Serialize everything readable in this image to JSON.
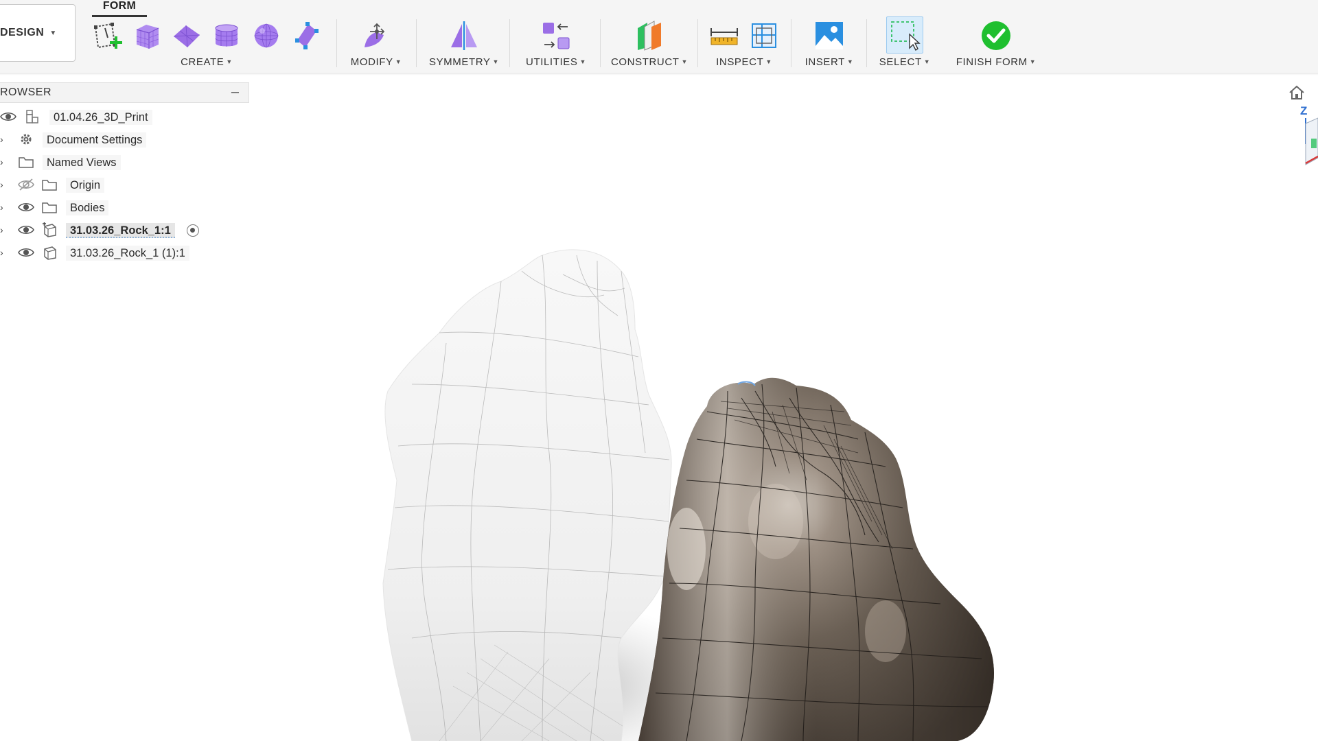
{
  "toolbar": {
    "workspace_label": "DESIGN",
    "active_tab": "FORM",
    "groups": {
      "create": "CREATE",
      "modify": "MODIFY",
      "symmetry": "SYMMETRY",
      "utilities": "UTILITIES",
      "construct": "CONSTRUCT",
      "inspect": "INSPECT",
      "insert": "INSERT",
      "select": "SELECT",
      "finish": "FINISH FORM"
    },
    "icons": {
      "create": [
        "create-sketch-icon",
        "box-icon",
        "plane-icon",
        "cylinder-icon",
        "sphere-icon",
        "face-icon"
      ],
      "modify": "edit-form-icon",
      "symmetry": "mirror-icon",
      "utilities": "convert-icon",
      "construct": "construct-plane-icon",
      "inspect": [
        "measure-icon",
        "section-analysis-icon"
      ],
      "insert": "insert-image-icon",
      "select": "window-select-icon",
      "finish": "checkmark-icon"
    },
    "colors": {
      "form_purple": "#9b6ee6",
      "finish_green": "#1fbf2f",
      "insert_blue": "#2a8fe0"
    }
  },
  "browser": {
    "title": "ROWSER",
    "items": [
      {
        "label": "01.04.26_3D_Print",
        "icon": "component-icon",
        "visible": true
      },
      {
        "label": "Document Settings",
        "icon": "gear-icon"
      },
      {
        "label": "Named Views",
        "icon": "folder-icon"
      },
      {
        "label": "Origin",
        "icon": "folder-icon",
        "visible": false
      },
      {
        "label": "Bodies",
        "icon": "folder-icon",
        "visible": true
      },
      {
        "label": "31.03.26_Rock_1:1",
        "icon": "component-icon",
        "visible": true,
        "active": true
      },
      {
        "label": "31.03.26_Rock_1 (1):1",
        "icon": "component-icon",
        "visible": true
      }
    ]
  },
  "viewcube": {
    "axis_label": "Z"
  }
}
